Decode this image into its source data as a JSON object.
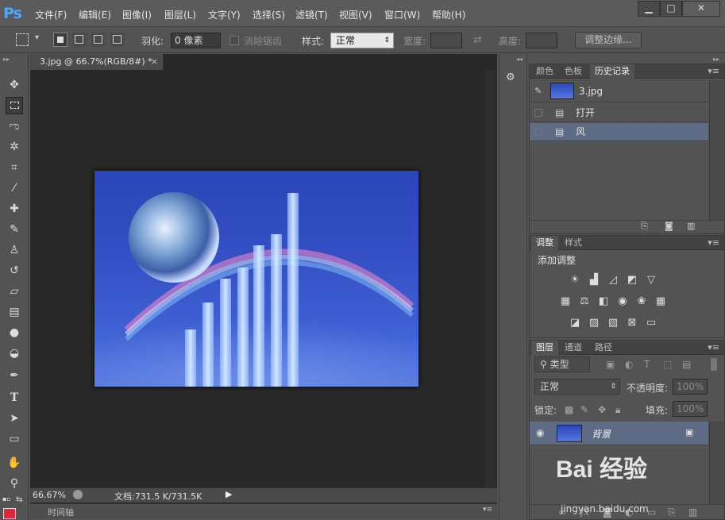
{
  "app": {
    "logo": "Ps"
  },
  "menu": [
    {
      "label": "文件(F)"
    },
    {
      "label": "编辑(E)"
    },
    {
      "label": "图像(I)"
    },
    {
      "label": "图层(L)"
    },
    {
      "label": "文字(Y)"
    },
    {
      "label": "选择(S)"
    },
    {
      "label": "滤镜(T)"
    },
    {
      "label": "视图(V)"
    },
    {
      "label": "窗口(W)"
    },
    {
      "label": "帮助(H)"
    }
  ],
  "window_controls": {
    "minimize": "▁",
    "maximize": "□",
    "close": "✕"
  },
  "options": {
    "feather_label": "羽化:",
    "feather_value": "0 像素",
    "antialias_label": "消除锯齿",
    "style_label": "样式:",
    "style_value": "正常",
    "width_label": "宽度:",
    "height_label": "高度:",
    "refine_edge": "调整边缘..."
  },
  "document": {
    "tab_title": "3.jpg @ 66.7%(RGB/8#) *",
    "tab_close": "×",
    "zoom": "66.67%",
    "doc_size": "文档:731.5 K/731.5K",
    "timeline_label": "时间轴"
  },
  "panel_history": {
    "tabs": [
      "颜色",
      "色板",
      "历史记录"
    ],
    "snapshot": "3.jpg",
    "states": [
      "打开",
      "风"
    ]
  },
  "panel_adjust": {
    "tabs": [
      "调整",
      "样式"
    ],
    "heading": "添加调整"
  },
  "panel_layers": {
    "tabs": [
      "图层",
      "通道",
      "路径"
    ],
    "kind_filter": "类型",
    "blend_mode": "正常",
    "opacity_label": "不透明度:",
    "opacity_value": "100%",
    "lock_label": "锁定:",
    "fill_label": "填充:",
    "fill_value": "100%",
    "layer_name": "背景"
  },
  "watermark": {
    "text": "Bai 经验",
    "sub": "jingyan.baidu.com"
  },
  "colors": {
    "accent": "#4ea6ff",
    "selected_row": "#5d6c84",
    "foreground": "#e0263a"
  }
}
